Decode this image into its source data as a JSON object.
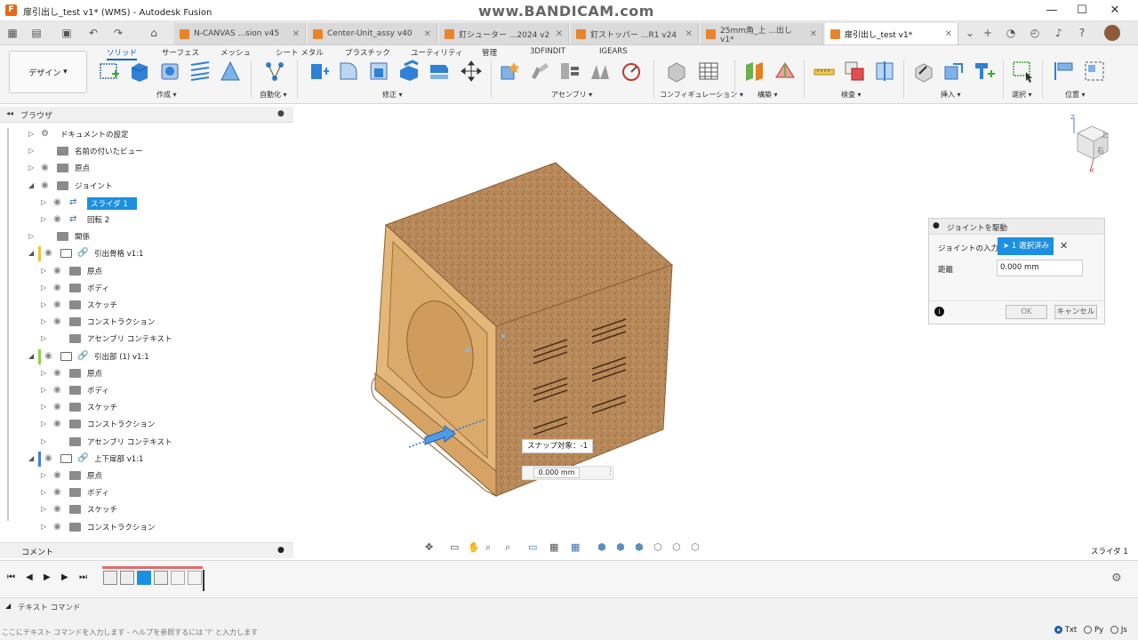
{
  "window": {
    "title": "扉引出し_test v1* (WMS) - Autodesk Fusion",
    "watermark": "www.BANDICAM.com",
    "app_icon": "F"
  },
  "tabs": [
    {
      "label": "N-CANVAS ...sion v45"
    },
    {
      "label": "Center-Unit_assy v40"
    },
    {
      "label": "釘シューター ...2024 v2"
    },
    {
      "label": "釘ストッパー ...R1 v24"
    },
    {
      "label": "25mm角_上 ...出し v1*"
    },
    {
      "label": "扉引出し_test v1*"
    }
  ],
  "ribbon": {
    "design_label": "デザイン",
    "tabs": [
      "ソリッド",
      "サーフェス",
      "メッシュ",
      "シート メタル",
      "プラスチック",
      "ユーティリティ",
      "管理",
      "3DFINDIT",
      "IGEARS"
    ],
    "groups": [
      "作成",
      "自動化",
      "修正",
      "アセンブリ",
      "コンフィギュレーション",
      "構築",
      "検査",
      "挿入",
      "選択",
      "位置"
    ]
  },
  "browser": {
    "title": "ブラウザ",
    "rows": [
      {
        "label": "ドキュメントの設定",
        "indent": 1,
        "arrow": "▷",
        "eye": false,
        "icon": "gear"
      },
      {
        "label": "名前の付いたビュー",
        "indent": 1,
        "arrow": "▷",
        "eye": false,
        "icon": "folder"
      },
      {
        "label": "原点",
        "indent": 1,
        "arrow": "▷",
        "eye": true,
        "icon": "folder"
      },
      {
        "label": "ジョイント",
        "indent": 1,
        "arrow": "◢",
        "eye": true,
        "icon": "folder"
      },
      {
        "label": "スライダ 1",
        "indent": 2,
        "arrow": "▷",
        "eye": true,
        "icon": "joint",
        "selected": true
      },
      {
        "label": "回転 2",
        "indent": 2,
        "arrow": "▷",
        "eye": true,
        "icon": "joint"
      },
      {
        "label": "関係",
        "indent": 1,
        "arrow": "▷",
        "eye": false,
        "icon": "folder"
      },
      {
        "label": "引出骨格 v1:1",
        "indent": 1,
        "arrow": "◢",
        "eye": true,
        "icon": "comp",
        "color": "#f0c040"
      },
      {
        "label": "原点",
        "indent": 2,
        "arrow": "▷",
        "eye": true,
        "icon": "folder"
      },
      {
        "label": "ボディ",
        "indent": 2,
        "arrow": "▷",
        "eye": true,
        "icon": "folder"
      },
      {
        "label": "スケッチ",
        "indent": 2,
        "arrow": "▷",
        "eye": true,
        "icon": "folder"
      },
      {
        "label": "コンストラクション",
        "indent": 2,
        "arrow": "▷",
        "eye": true,
        "icon": "folder"
      },
      {
        "label": "アセンブリ コンテキスト",
        "indent": 2,
        "arrow": "▷",
        "eye": false,
        "icon": "folder"
      },
      {
        "label": "引出部 (1) v1:1",
        "indent": 1,
        "arrow": "◢",
        "eye": true,
        "icon": "comp",
        "color": "#8fd44a"
      },
      {
        "label": "原点",
        "indent": 2,
        "arrow": "▷",
        "eye": true,
        "icon": "folder"
      },
      {
        "label": "ボディ",
        "indent": 2,
        "arrow": "▷",
        "eye": true,
        "icon": "folder"
      },
      {
        "label": "スケッチ",
        "indent": 2,
        "arrow": "▷",
        "eye": true,
        "icon": "folder"
      },
      {
        "label": "コンストラクション",
        "indent": 2,
        "arrow": "▷",
        "eye": true,
        "icon": "folder"
      },
      {
        "label": "アセンブリ コンテキスト",
        "indent": 2,
        "arrow": "▷",
        "eye": false,
        "icon": "folder"
      },
      {
        "label": "上下扉部 v1:1",
        "indent": 1,
        "arrow": "◢",
        "eye": true,
        "icon": "comp",
        "color": "#3f7fe0"
      },
      {
        "label": "原点",
        "indent": 2,
        "arrow": "▷",
        "eye": true,
        "icon": "folder"
      },
      {
        "label": "ボディ",
        "indent": 2,
        "arrow": "▷",
        "eye": true,
        "icon": "folder"
      },
      {
        "label": "スケッチ",
        "indent": 2,
        "arrow": "▷",
        "eye": true,
        "icon": "folder"
      },
      {
        "label": "コンストラクション",
        "indent": 2,
        "arrow": "▷",
        "eye": true,
        "icon": "folder"
      }
    ]
  },
  "comment": {
    "label": "コメント"
  },
  "viewport": {
    "snap_label": "スナップ対象：-1",
    "distance_input": "0.000 mm",
    "status_right": "スライダ 1",
    "viewcube": {
      "top": "上",
      "right": "右",
      "axis_z": "Z",
      "axis_x": "X"
    }
  },
  "joint_panel": {
    "title": "ジョイントを駆動",
    "joint_input_label": "ジョイントの入力",
    "selected_label": "1 選択済み",
    "distance_label": "距離",
    "distance_value": "0.000 mm",
    "ok": "OK",
    "cancel": "キャンセル"
  },
  "text_commands": {
    "title": "テキスト コマンド",
    "placeholder": "ここにテキスト コマンドを入力します - ヘルプを参照するには '?' と入力します",
    "modes": [
      "Txt",
      "Py",
      "Js"
    ],
    "selected_mode": "Txt"
  },
  "colors": {
    "accent": "#0a64c8",
    "selection": "#1d8fe0",
    "timeline_bar": "#e46a6a",
    "wood": "#b78a55"
  }
}
